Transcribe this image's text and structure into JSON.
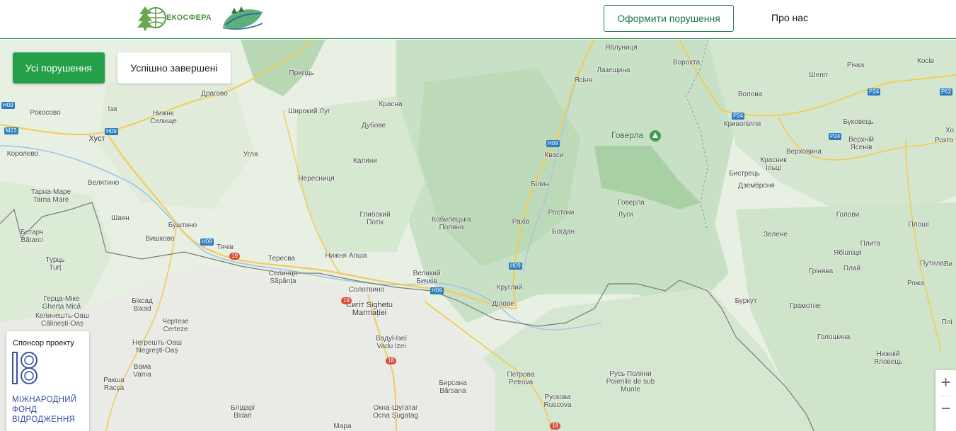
{
  "header": {
    "logo_text": "ЕКОСФЕРА",
    "cta_label": "Оформити порушення",
    "about_label": "Про нас"
  },
  "filters": {
    "all_label": "Усі порушення",
    "done_label": "Успішно завершені"
  },
  "sponsor": {
    "title": "Спонсор проекту",
    "name_lines": [
      "МІЖНАРОДНИЙ",
      "ФОНД",
      "ВІДРОДЖЕННЯ"
    ]
  },
  "zoom": {
    "in": "+",
    "out": "−"
  },
  "map": {
    "peak_label": "Говерла",
    "places": [
      {
        "name": "Яблуниця"
      },
      {
        "name": "Ворохта"
      },
      {
        "name": "Косів"
      },
      {
        "name": "Річка"
      },
      {
        "name": "Шепіт"
      },
      {
        "name": "Пригідь"
      },
      {
        "name": "Лазещина"
      },
      {
        "name": "Ясіня"
      },
      {
        "name": "Волова"
      },
      {
        "name": "Драгово"
      },
      {
        "name": "Красна"
      },
      {
        "name": "Рокосово"
      },
      {
        "name": "Іза"
      },
      {
        "name": "Широкий Луг"
      },
      {
        "name": "Нижнє Селище"
      },
      {
        "name": "Хуст"
      },
      {
        "name": "Дубове"
      },
      {
        "name": "Кривопілля"
      },
      {
        "name": "Буковець"
      },
      {
        "name": "Угля"
      },
      {
        "name": "Кваси"
      },
      {
        "name": "Верхній Ясенів"
      },
      {
        "name": "Королево"
      },
      {
        "name": "Верховина"
      },
      {
        "name": "Красник Ільці"
      },
      {
        "name": "Калини"
      },
      {
        "name": "Бистрець"
      },
      {
        "name": "Нересниця"
      },
      {
        "name": "Дземброня"
      },
      {
        "name": "Велятино"
      },
      {
        "name": "Білин"
      },
      {
        "name": "Тарна-Маре Tarna Mare"
      },
      {
        "name": "Говерла"
      },
      {
        "name": "Луги"
      },
      {
        "name": "Ростоки"
      },
      {
        "name": "Голови"
      },
      {
        "name": "Глибокий Потік"
      },
      {
        "name": "Кобилецька Поляна"
      },
      {
        "name": "Рахів"
      },
      {
        "name": "Шаян"
      },
      {
        "name": "Буштино"
      },
      {
        "name": "Богдан"
      },
      {
        "name": "Зелене"
      },
      {
        "name": "Бетарч Bătarci"
      },
      {
        "name": "Вишково"
      },
      {
        "name": "Тячів"
      },
      {
        "name": "Плита"
      },
      {
        "name": "Тересва"
      },
      {
        "name": "Нижня Апша"
      },
      {
        "name": "Ябluniця"
      },
      {
        "name": "Турць Turț"
      },
      {
        "name": "Грінява"
      },
      {
        "name": "Плай"
      },
      {
        "name": "Великий Бичків"
      },
      {
        "name": "Селинця Săpânța"
      },
      {
        "name": "Солотвино"
      },
      {
        "name": "Круглий"
      },
      {
        "name": "Біксад Bixad"
      },
      {
        "name": "Герца-Міке Gherța Mică"
      },
      {
        "name": "Сигіт Sighetu Marmației"
      },
      {
        "name": "Ділове"
      },
      {
        "name": "Буркут"
      },
      {
        "name": "Грамотне"
      },
      {
        "name": "Келинешть-Оаш Călinești-Oaș"
      },
      {
        "name": "Чертезе Certeze"
      },
      {
        "name": "Голошина"
      },
      {
        "name": "Вадуl-Ізеї Vadu Izei"
      },
      {
        "name": "Негрешть-Оаш Negrești-Oaș"
      },
      {
        "name": "Нижній Яловець"
      },
      {
        "name": "Вама Vama"
      },
      {
        "name": "Русь Поляни Poienile de sub Munte"
      },
      {
        "name": "Петрова Petrova"
      },
      {
        "name": "Ракша Racșa"
      },
      {
        "name": "Бирсана Bârsana"
      },
      {
        "name": "Рускова Ruscova"
      },
      {
        "name": "Блідарі Bidari"
      },
      {
        "name": "Окна-Шугатаг Ocna Șugatag"
      },
      {
        "name": "Мара"
      },
      {
        "name": "Путила"
      },
      {
        "name": "Рожа"
      },
      {
        "name": "Хо"
      },
      {
        "name": "Розто"
      },
      {
        "name": "Плоші"
      },
      {
        "name": "Ви"
      },
      {
        "name": "Плі"
      }
    ],
    "road_shields": [
      "H09",
      "M23",
      "H09",
      "H09",
      "H09",
      "H09",
      "P24",
      "P24",
      "P24",
      "P62",
      "19",
      "19",
      "18",
      "18"
    ]
  }
}
